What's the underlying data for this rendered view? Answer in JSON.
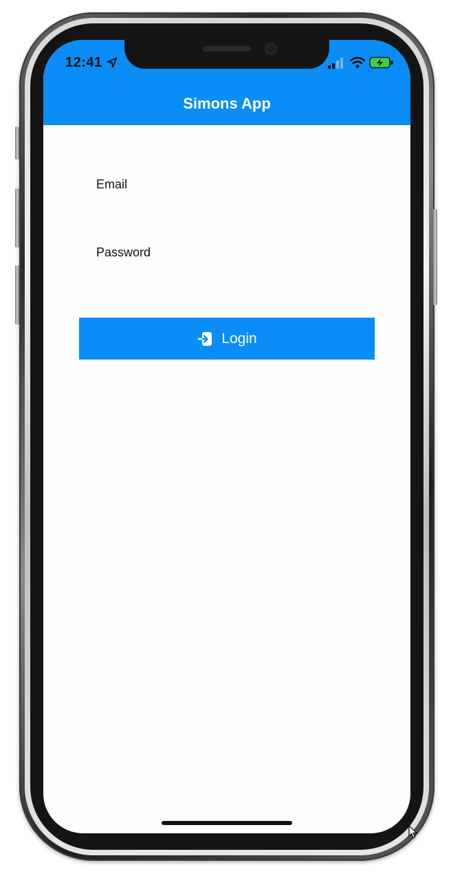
{
  "status_bar": {
    "time": "12:41",
    "icons": [
      "location-arrow-icon",
      "cellular-signal-icon",
      "wifi-icon",
      "battery-charging-icon"
    ]
  },
  "header": {
    "title": "Simons App"
  },
  "form": {
    "email_label": "Email",
    "email_value": "",
    "password_label": "Password",
    "password_value": ""
  },
  "login_button": {
    "label": "Login",
    "icon": "login-arrow-icon"
  },
  "colors": {
    "accent": "#0a8df7",
    "background": "#fefefe",
    "text": "#111111"
  }
}
